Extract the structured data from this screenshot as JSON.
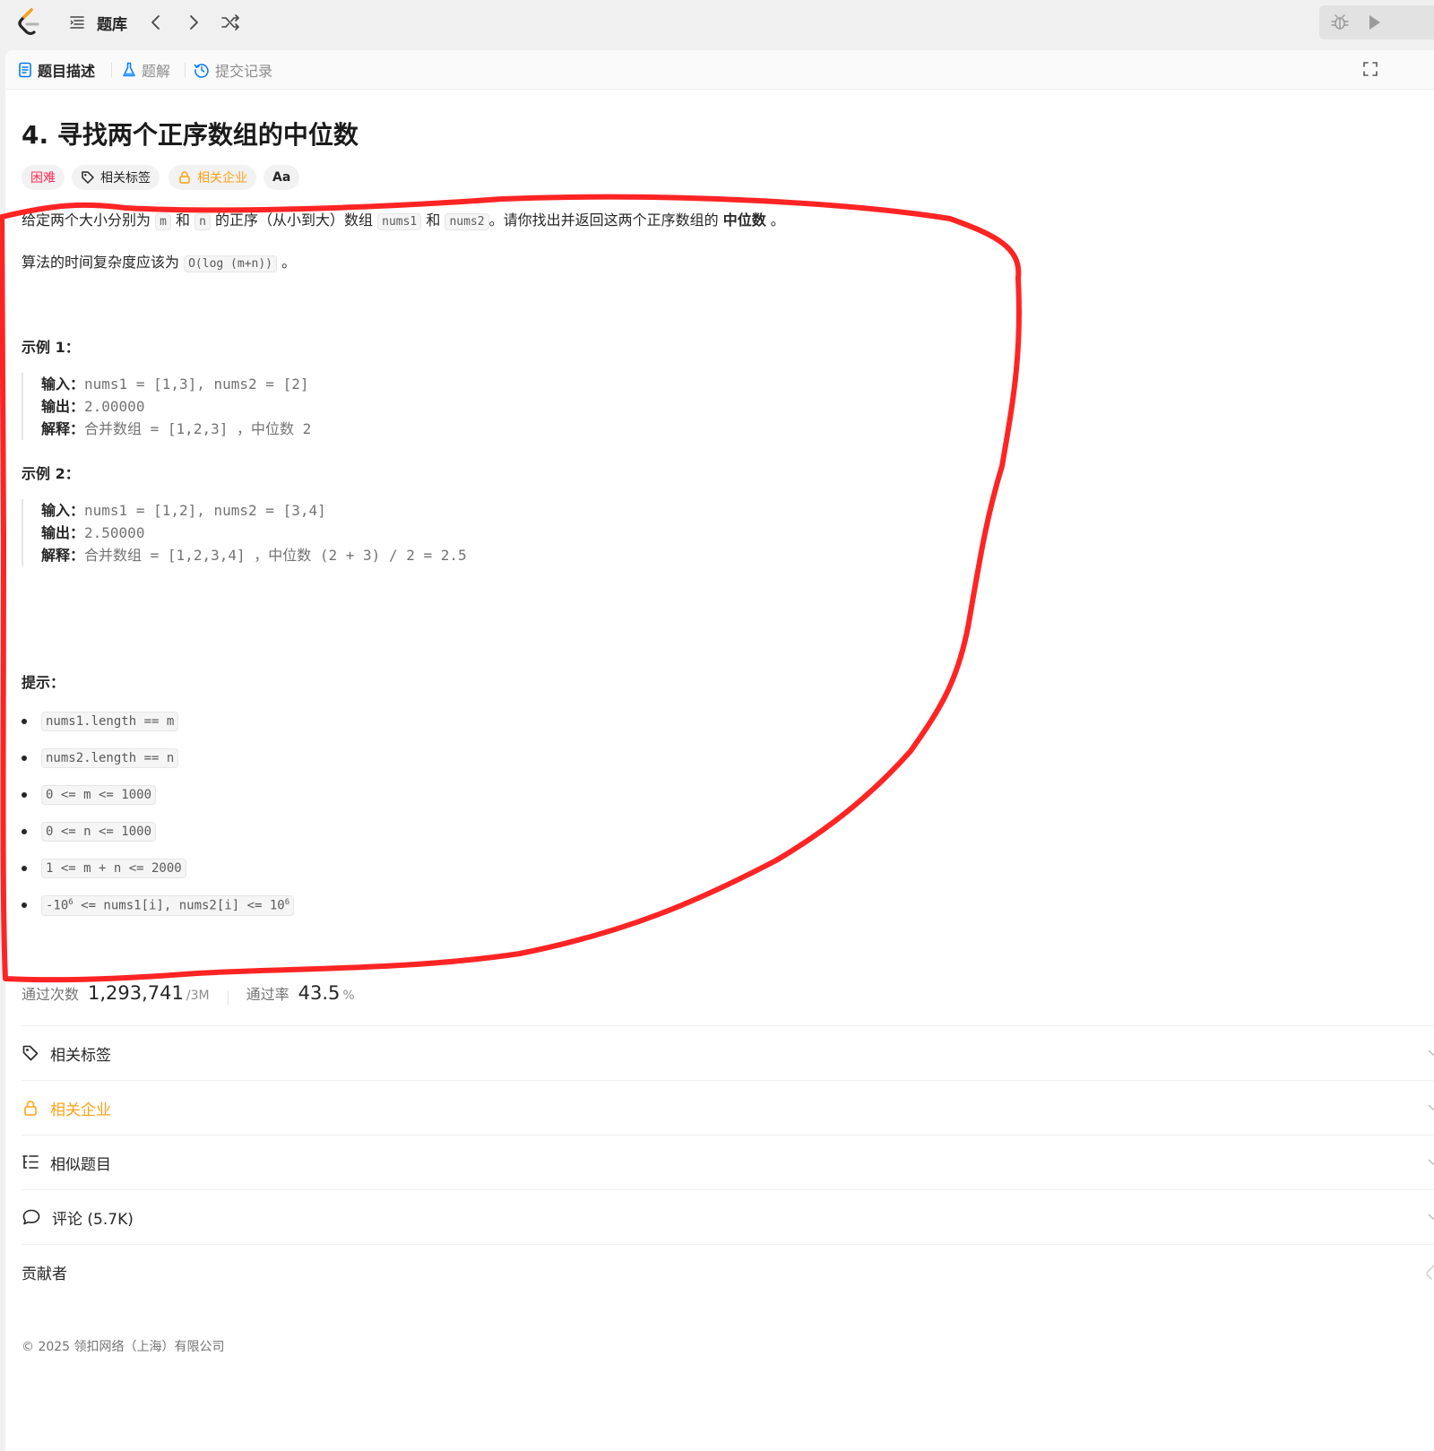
{
  "topbar": {
    "title": "题库"
  },
  "tabs": [
    {
      "label": "题目描述"
    },
    {
      "label": "题解"
    },
    {
      "label": "提交记录"
    }
  ],
  "problem": {
    "title": "4. 寻找两个正序数组的中位数",
    "tags": {
      "difficulty": "困难",
      "topics": "相关标签",
      "companies": "相关企业",
      "translate": "Aa"
    },
    "description": {
      "p1_a": "给定两个大小分别为 ",
      "p1_code_m": "m",
      "p1_b": " 和 ",
      "p1_code_n": "n",
      "p1_c": " 的正序（从小到大）数组 ",
      "p1_code_nums1": "nums1",
      "p1_d": " 和 ",
      "p1_code_nums2": "nums2",
      "p1_e": "。请你找出并返回这两个正序数组的 ",
      "p1_bold": "中位数",
      "p1_f": " 。",
      "p2_a": "算法的时间复杂度应该为 ",
      "p2_code": "O(log (m+n))",
      "p2_b": " 。"
    },
    "examples": [
      {
        "heading": "示例 1：",
        "input_label": "输入：",
        "input": "nums1 = [1,3], nums2 = [2]",
        "output_label": "输出：",
        "output": "2.00000",
        "explain_label": "解释：",
        "explain": "合并数组 = [1,2,3] ，中位数 2"
      },
      {
        "heading": "示例 2：",
        "input_label": "输入：",
        "input": "nums1 = [1,2], nums2 = [3,4]",
        "output_label": "输出：",
        "output": "2.50000",
        "explain_label": "解释：",
        "explain": "合并数组 = [1,2,3,4] ，中位数 (2 + 3) / 2 = 2.5"
      }
    ],
    "hints_heading": "提示：",
    "constraints": [
      "nums1.length == m",
      "nums2.length == n",
      "0 <= m <= 1000",
      "0 <= n <= 1000",
      "1 <= m + n <= 2000"
    ],
    "constraint_last": {
      "a": "-10",
      "sup1": "6",
      "b": " <= nums1[i], nums2[i] <= 10",
      "sup2": "6"
    }
  },
  "stats": {
    "accepted_label": "通过次数",
    "accepted_value": "1,293,741",
    "accepted_unit": "/3M",
    "rate_label": "通过率",
    "rate_value": "43.5",
    "rate_unit": "%"
  },
  "sections": [
    {
      "label": "相关标签"
    },
    {
      "label": "相关企业"
    },
    {
      "label": "相似题目"
    },
    {
      "label": "评论 (5.7K)"
    },
    {
      "label": "贡献者"
    }
  ],
  "footer": {
    "copyright": "© 2025 领扣网络（上海）有限公司"
  },
  "colors": {
    "accent_blue": "#007aff",
    "difficulty_red": "#ff2d55",
    "premium_orange": "#ffa116",
    "annotation_red": "#ff2424"
  }
}
